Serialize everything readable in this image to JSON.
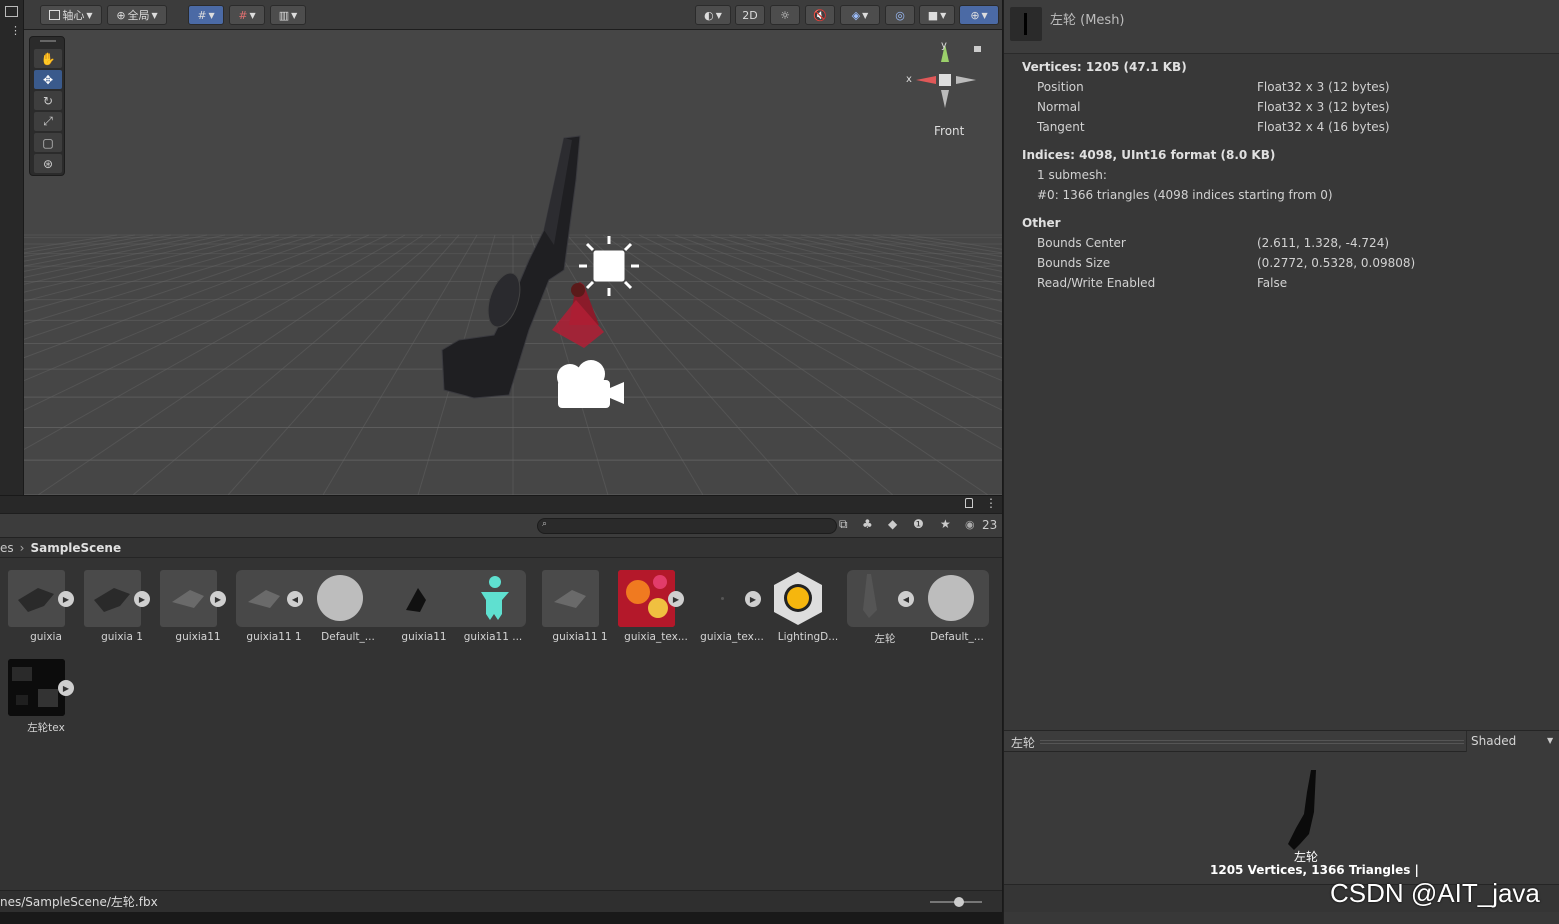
{
  "scene_toolbar": {
    "pivot_label": "轴心",
    "global_label": "全局",
    "mode_2d_label": "2D"
  },
  "gizmo": {
    "y_axis_label": "y",
    "x_axis_label": "x",
    "view_label": "Front"
  },
  "project": {
    "breadcrumb_prefix": "es",
    "breadcrumb_current": "SampleScene",
    "search_placeholder": "",
    "visible_count": "23",
    "assets": [
      {
        "label": "guixia"
      },
      {
        "label": "guixia 1"
      },
      {
        "label": "guixia11"
      },
      {
        "label": "guixia11 1"
      },
      {
        "label": "Default_..."
      },
      {
        "label": "guixia11"
      },
      {
        "label": "guixia11 ..."
      },
      {
        "label": "guixia11 1"
      },
      {
        "label": "guixia_tex..."
      },
      {
        "label": "guixia_tex..."
      },
      {
        "label": "LightingD..."
      },
      {
        "label": "左轮"
      },
      {
        "label": "Default_..."
      },
      {
        "label": "左轮tex"
      }
    ],
    "status_path": "nes/SampleScene/左轮.fbx"
  },
  "inspector": {
    "title": "左轮 (Mesh)",
    "vertices_header": "Vertices: 1205 (47.1 KB)",
    "vertex_attrs": [
      {
        "name": "Position",
        "value": "Float32 x 3 (12 bytes)"
      },
      {
        "name": "Normal",
        "value": "Float32 x 3 (12 bytes)"
      },
      {
        "name": "Tangent",
        "value": "Float32 x 4 (16 bytes)"
      }
    ],
    "indices_header": "Indices: 4098, UInt16 format (8.0 KB)",
    "submesh_count": "1 submesh:",
    "submesh_detail": "#0: 1366 triangles (4098 indices starting from 0)",
    "other_header": "Other",
    "other_props": [
      {
        "name": "Bounds Center",
        "value": "(2.611, 1.328, -4.724)"
      },
      {
        "name": "Bounds Size",
        "value": "(0.2772, 0.5328, 0.09808)"
      },
      {
        "name": "Read/Write Enabled",
        "value": "False"
      }
    ],
    "preview_title": "左轮",
    "preview_mode": "Shaded",
    "preview_mesh_label": "左轮",
    "preview_stats": "1205 Vertices, 1366 Triangles |"
  },
  "watermark": "CSDN @AIT_java",
  "colors": {
    "accent_blue": "#4b6aa5",
    "panel_bg": "#383838",
    "viewport_bg": "#464646"
  }
}
